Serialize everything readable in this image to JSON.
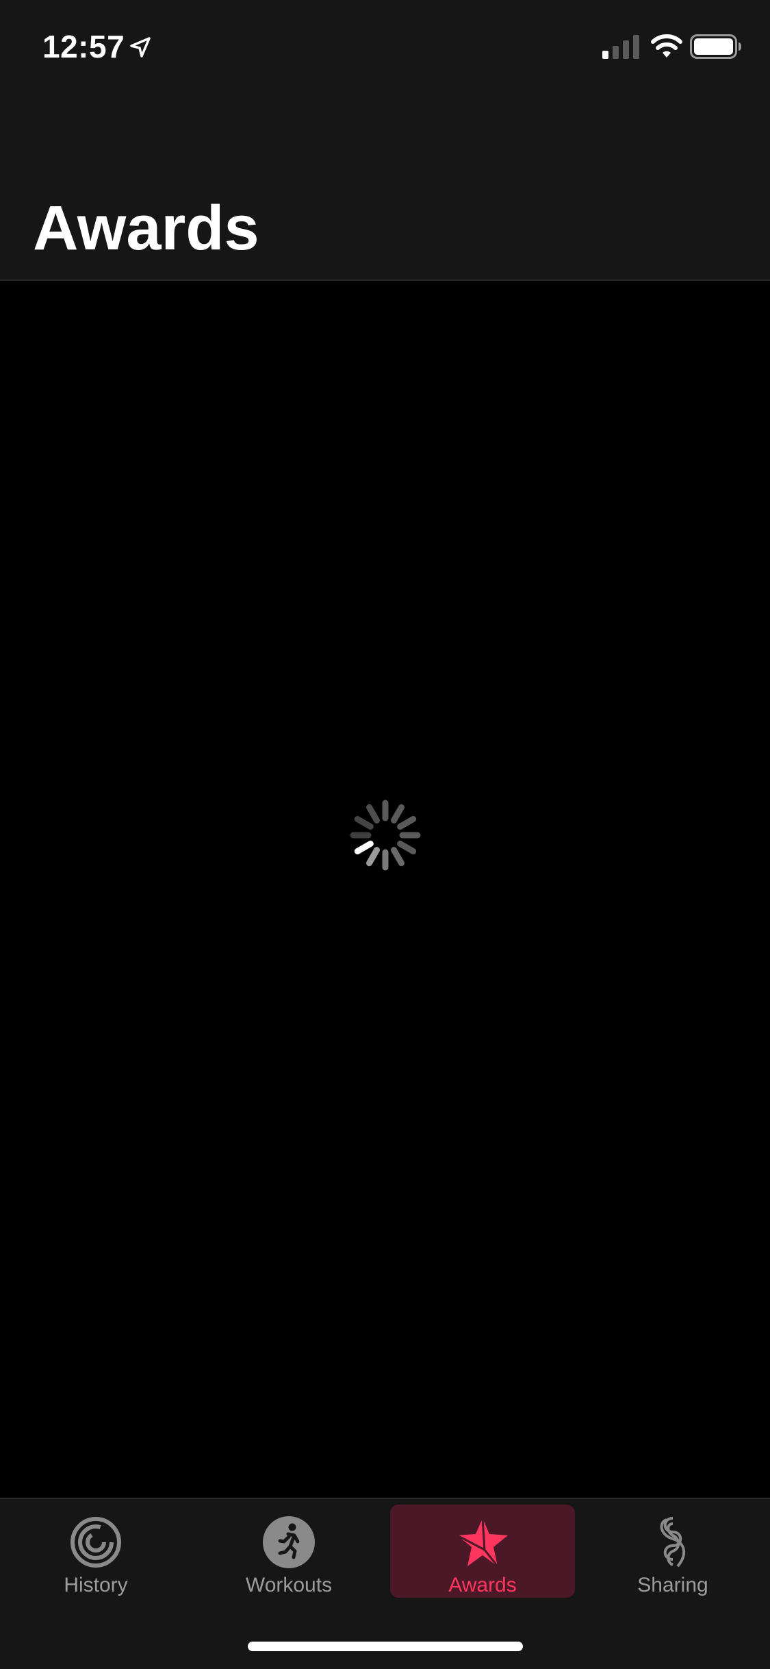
{
  "status_bar": {
    "time": "12:57",
    "icons": [
      "location-arrow-icon",
      "cellular-signal-icon",
      "wifi-icon",
      "battery-icon"
    ]
  },
  "header": {
    "title": "Awards"
  },
  "content": {
    "state": "loading",
    "indicator": "activity-spinner-icon"
  },
  "tab_bar": {
    "selected": "Awards",
    "tabs": [
      {
        "label": "History",
        "icon": "activity-rings-icon"
      },
      {
        "label": "Workouts",
        "icon": "running-figure-icon"
      },
      {
        "label": "Awards",
        "icon": "star-award-icon"
      },
      {
        "label": "Sharing",
        "icon": "sharing-rings-icon"
      }
    ]
  },
  "colors": {
    "accent": "#ff375f",
    "selected_tab_bg": "#4a1826",
    "bar_bg": "#161616",
    "background": "#000000",
    "inactive_label": "#9c9c9c"
  }
}
